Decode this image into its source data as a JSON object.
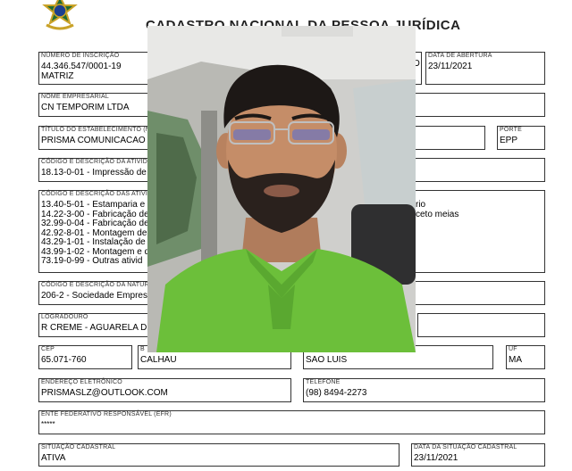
{
  "title": "CADASTRO NACIONAL DA PESSOA JURÍDICA",
  "inscricao": {
    "label": "NÚMERO DE INSCRIÇÃO",
    "number": "44.346.547/0001-19",
    "type": "MATRIZ"
  },
  "partial_o": "O",
  "abertura": {
    "label": "DATA DE ABERTURA",
    "value": "23/11/2021"
  },
  "nome_empresarial": {
    "label": "NOME EMPRESARIAL",
    "value": "CN TEMPORIM LTDA"
  },
  "titulo": {
    "label": "TÍTULO DO ESTABELECIMENTO (N",
    "value": "PRISMA COMUNICACAO"
  },
  "porte": {
    "label": "PORTE",
    "value": "EPP"
  },
  "atividade_principal": {
    "label": "CÓDIGO E DESCRIÇÃO DA ATIVID",
    "value": "18.13-0-01 - Impressão de"
  },
  "atividades_secundarias": {
    "label": "CÓDIGO E DESCRIÇÃO DAS ATIVI",
    "items": [
      "13.40-5-01 - Estamparia e",
      "14.22-3-00 - Fabricação de",
      "32.99-0-04 - Fabricação de",
      "42.92-8-01 - Montagem de",
      "43.29-1-01 - Instalação de",
      "43.99-1-02 - Montagem e d",
      "73.19-0-99 - Outras ativid"
    ],
    "right_fragments": [
      "rio",
      "ceto meias"
    ]
  },
  "natureza": {
    "label": "CÓDIGO E DESCRIÇÃO DA NATUR",
    "value": "206-2 - Sociedade Empres"
  },
  "logradouro": {
    "label": "LOGRADOURO",
    "value": "R CREME - AGUARELA D"
  },
  "cep": {
    "label": "CEP",
    "value": "65.071-760"
  },
  "bairro": {
    "label": "B",
    "value": "CALHAU"
  },
  "municipio": {
    "value": "SAO LUIS"
  },
  "uf": {
    "label": "UF",
    "value": "MA"
  },
  "email": {
    "label": "ENDEREÇO ELETRÔNICO",
    "value": "PRISMASLZ@OUTLOOK.COM"
  },
  "telefone": {
    "label": "TELEFONE",
    "value": "(98) 8494-2273"
  },
  "efr": {
    "label": "ENTE FEDERATIVO RESPONSÁVEL (EFR)",
    "value": "*****"
  },
  "situacao": {
    "label": "SITUAÇÃO CADASTRAL",
    "value": "ATIVA"
  },
  "data_situacao": {
    "label": "DATA DA SITUAÇÃO CADASTRAL",
    "value": "23/11/2021"
  },
  "colors": {
    "shirt": "#6cbf3a",
    "border": "#333333"
  }
}
